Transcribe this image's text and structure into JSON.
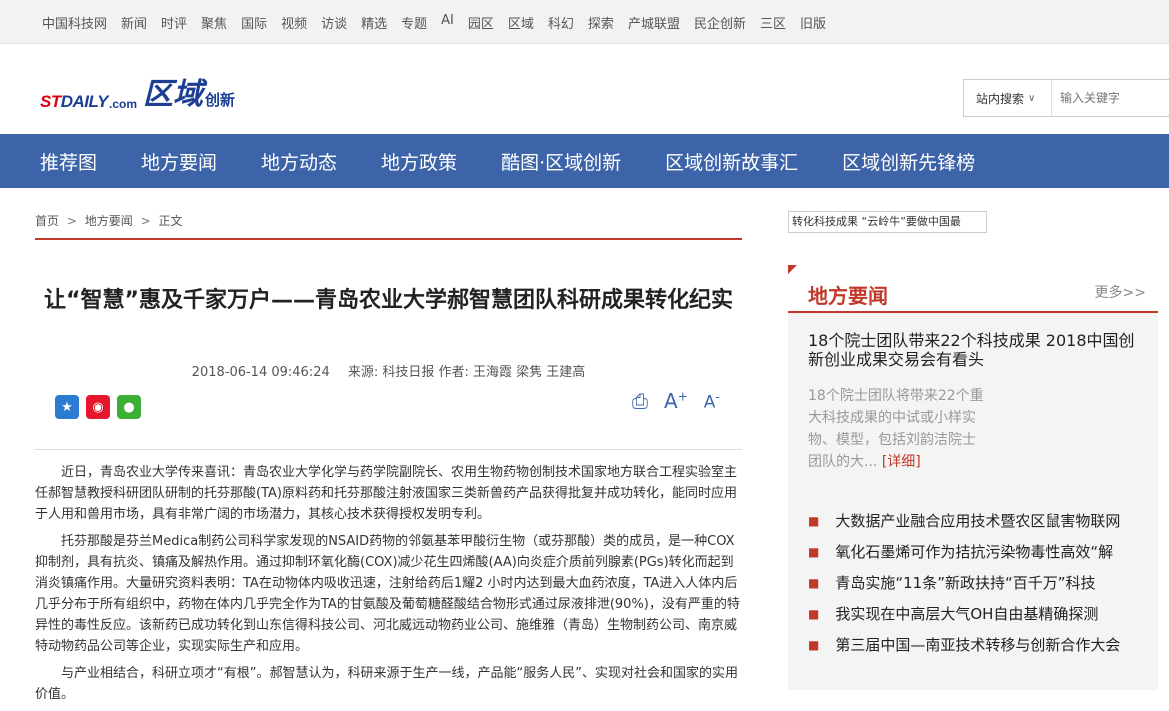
{
  "topnav": [
    "中国科技网",
    "新闻",
    "时评",
    "聚焦",
    "国际",
    "视频",
    "访谈",
    "精选",
    "专题",
    "AI",
    "园区",
    "区域",
    "科幻",
    "探索",
    "产城联盟",
    "民企创新",
    "三区",
    "旧版"
  ],
  "logo": {
    "brand_st": "ST",
    "brand_daily": "DAILY",
    "brand_com": ".com",
    "section": "区域",
    "section_sub": "创新"
  },
  "search": {
    "scope": "站内搜索",
    "placeholder": "输入关键字"
  },
  "mainnav": [
    "推荐图",
    "地方要闻",
    "地方动态",
    "地方政策",
    "酷图·区域创新",
    "区域创新故事汇",
    "区域创新先锋榜"
  ],
  "breadcrumb": [
    "首页",
    "地方要闻",
    "正文"
  ],
  "breadcrumb_sep": ">",
  "article": {
    "title": "让“智慧”惠及千家万户——青岛农业大学郝智慧团队科研成果转化纪实",
    "date": "2018-06-14 09:46:24",
    "source": "来源: 科技日报 作者: 王海霞 梁隽 王建高",
    "paragraphs": [
      "近日，青岛农业大学传来喜讯：青岛农业大学化学与药学院副院长、农用生物药物创制技术国家地方联合工程实验室主任郝智慧教授科研团队研制的托芬那酸(TA)原料药和托芬那酸注射液国家三类新兽药产品获得批复并成功转化，能同时应用于人用和兽用市场，具有非常广阔的市场潜力，其核心技术获得授权发明专利。",
      "托芬那酸是芬兰Medica制药公司科学家发现的NSAID药物的邻氨基苯甲酸衍生物（或芬那酸）类的成员，是一种COX抑制剂，具有抗炎、镇痛及解热作用。通过抑制环氧化酶(COX)减少花生四烯酸(AA)向炎症介质前列腺素(PGs)转化而起到消炎镇痛作用。大量研究资料表明：TA在动物体内吸收迅速，注射给药后1耀2 小时内达到最大血药浓度，TA进入人体内后几乎分布于所有组织中，药物在体内几乎完全作为TA的甘氨酸及葡萄糖醛酸结合物形式通过尿液排泄(90%)，没有严重的特异性的毒性反应。该新药已成功转化到山东信得科技公司、河北威远动物药业公司、施维雅（青岛）生物制药公司、南京威特动物药品公司等企业，实现实际生产和应用。",
      "与产业相结合，科研立项才“有根”。郝智慧认为，科研来源于生产一线，产品能“服务人民”、实现对社会和国家的实用价值。"
    ]
  },
  "tools": {
    "print": "print-icon",
    "font_up": "A+",
    "font_down": "A-"
  },
  "ticker": "转化科技成果 “云岭牛”要做中国最",
  "sidebar": {
    "title": "地方要闻",
    "more": "更多>>",
    "lead_title": "18个院士团队带来22个科技成果 2018中国创新创业成果交易会有看头",
    "lead_desc": "18个院士团队将带来22个重大科技成果的中试或小样实物、模型，包括刘韵洁院士团队的大...",
    "detail_label": "[详细]",
    "items": [
      "大数据产业融合应用技术暨农区鼠害物联网",
      "氧化石墨烯可作为拮抗污染物毒性高效“解",
      "青岛实施“11条”新政扶持“百千万”科技",
      "我实现在中高层大气OH自由基精确探测",
      "第三届中国—南亚技术转移与创新合作大会"
    ]
  }
}
